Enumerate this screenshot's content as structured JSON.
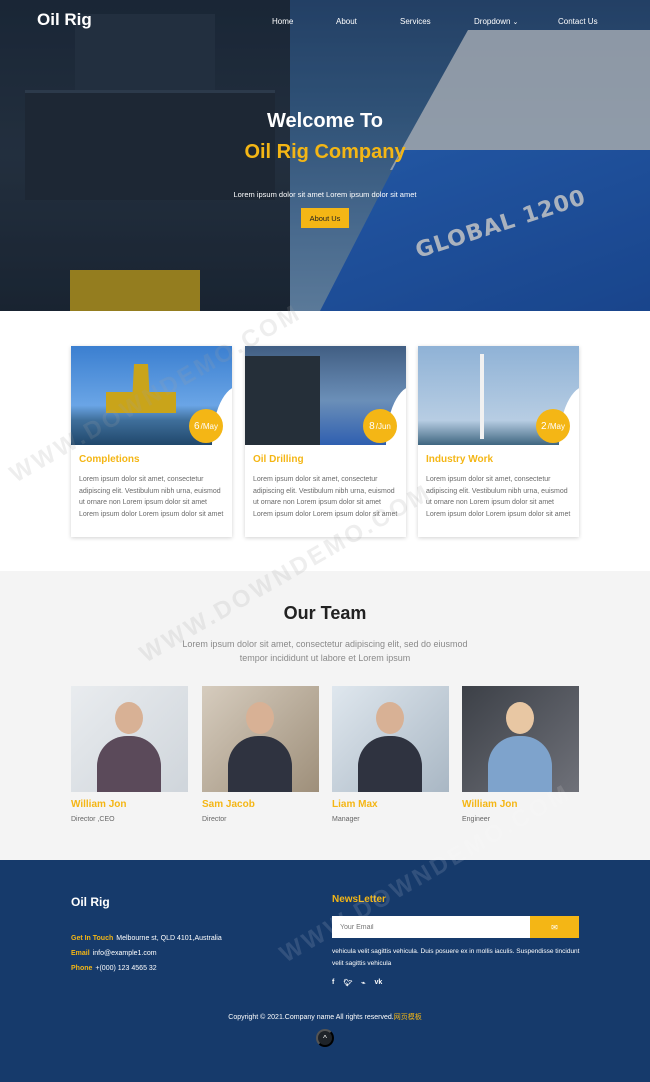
{
  "nav": {
    "logo": "Oil Rig",
    "items": [
      "Home",
      "About",
      "Services",
      "Dropdown",
      "Contact Us"
    ]
  },
  "hero": {
    "title": "Welcome To",
    "subtitle": "Oil Rig Company",
    "text": "Lorem ipsum dolor sit amet Lorem ipsum dolor sit amet",
    "button": "About Us",
    "ship_label": "GLOBAL 1200"
  },
  "cards": [
    {
      "day": "6",
      "month": "/May",
      "title": "Completions",
      "text": "Lorem ipsum dolor sit amet, consectetur adipiscing elit. Vestibulum nibh urna, euismod ut ornare non Lorem ipsum dolor sit amet Lorem ipsum dolor Lorem ipsum dolor sit amet"
    },
    {
      "day": "8",
      "month": "/Jun",
      "title": "Oil Drilling",
      "text": "Lorem ipsum dolor sit amet, consectetur adipiscing elit. Vestibulum nibh urna, euismod ut ornare non Lorem ipsum dolor sit amet Lorem ipsum dolor Lorem ipsum dolor sit amet"
    },
    {
      "day": "2",
      "month": "/May",
      "title": "Industry Work",
      "text": "Lorem ipsum dolor sit amet, consectetur adipiscing elit. Vestibulum nibh urna, euismod ut ornare non Lorem ipsum dolor sit amet Lorem ipsum dolor Lorem ipsum dolor sit amet"
    }
  ],
  "team": {
    "title": "Our Team",
    "description": "Lorem ipsum dolor sit amet, consectetur adipiscing elit, sed do eiusmod tempor incididunt ut labore et Lorem ipsum",
    "members": [
      {
        "name": "William Jon",
        "role": "Director ,CEO"
      },
      {
        "name": "Sam Jacob",
        "role": "Director"
      },
      {
        "name": "Liam Max",
        "role": "Manager"
      },
      {
        "name": "William Jon",
        "role": "Engineer"
      }
    ]
  },
  "footer": {
    "logo": "Oil Rig",
    "get_in_touch_label": "Get In Touch",
    "address": "Melbourne st, QLD 4101,Australia",
    "email_label": "Email",
    "email": "info@example1.com",
    "phone_label": "Phone",
    "phone": "+(000) 123 4565 32",
    "newsletter_title": "NewsLetter",
    "newsletter_placeholder": "Your Email",
    "newsletter_button": "✉",
    "newsletter_text": "vehicula velit sagittis vehicula. Duis posuere ex in mollis iaculis. Suspendisse tincidunt velit sagittis vehicula",
    "socials": [
      "f",
      "t",
      "rss",
      "vk"
    ],
    "copyright": "Copyright © 2021.Company name All rights reserved.",
    "copyright_link": "网页模板",
    "to_top": "^"
  },
  "watermark": "WWW.DOWNDEMO.COM",
  "colors": {
    "accent": "#f4b615",
    "footer_bg": "#163a6b",
    "team_bg": "#f4f4f4"
  }
}
